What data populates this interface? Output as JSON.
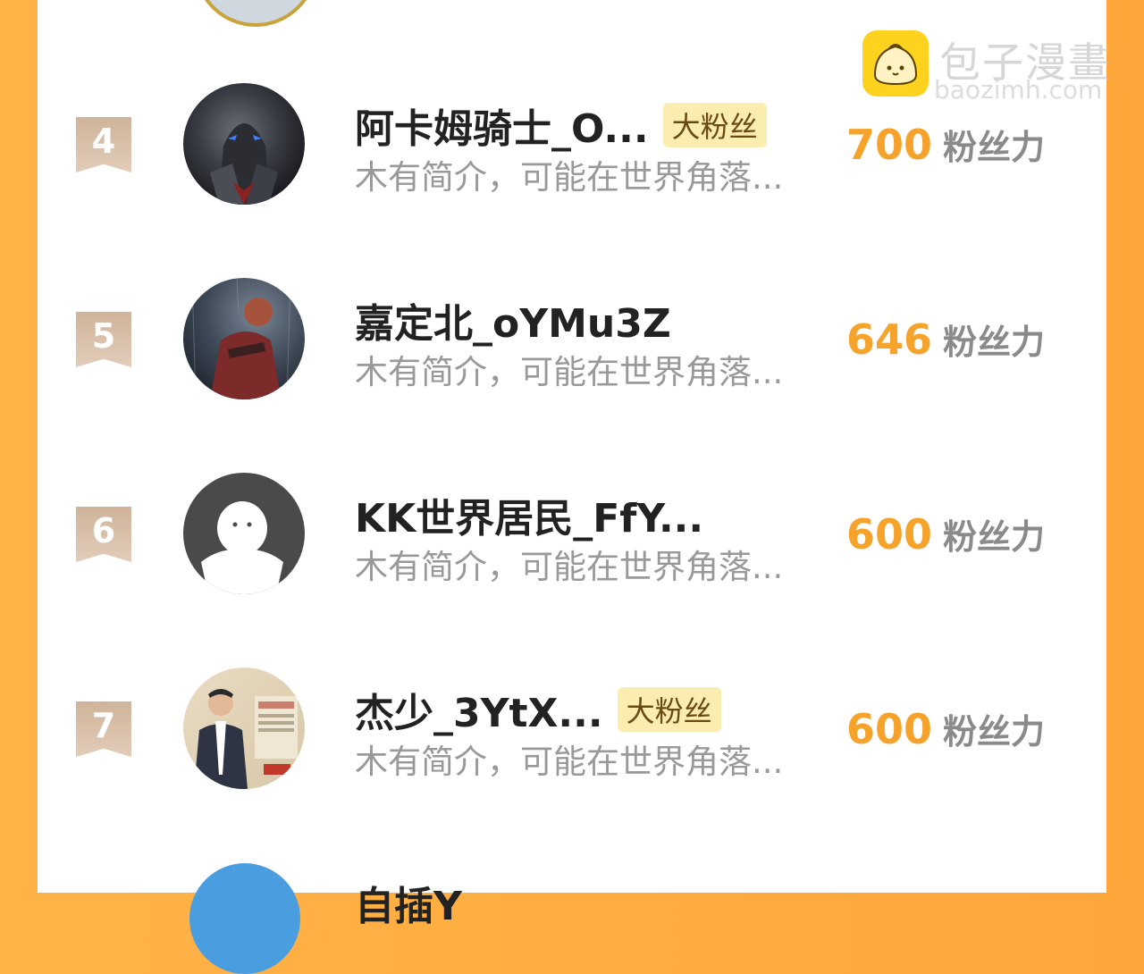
{
  "watermark": {
    "title": "包子漫畫",
    "subtitle": "baozimh.com",
    "icon": "bun-mascot-icon",
    "color": "#ffd21f"
  },
  "colors": {
    "accent": "#f5a32a",
    "badge_bg": "#fbecb0",
    "rank_badge": "#d4b9a2",
    "frame": "#ffa63a"
  },
  "rows": [
    {
      "rank": "4",
      "name": "阿卡姆骑士_O...",
      "badge": "大粉丝",
      "intro": "木有简介，可能在世界角落...",
      "fans": "700",
      "fans_unit": "粉丝力",
      "avatar": "armored-knight-avatar"
    },
    {
      "rank": "5",
      "name": "嘉定北_oYMu3Z",
      "badge": "",
      "intro": "木有简介，可能在世界角落...",
      "fans": "646",
      "fans_unit": "粉丝力",
      "avatar": "rainy-character-avatar"
    },
    {
      "rank": "6",
      "name": "KK世界居民_FfY...",
      "badge": "",
      "intro": "木有简介，可能在世界角落...",
      "fans": "600",
      "fans_unit": "粉丝力",
      "avatar": "default-user-avatar"
    },
    {
      "rank": "7",
      "name": "杰少_3YtX...",
      "badge": "大粉丝",
      "intro": "木有简介，可能在世界角落...",
      "fans": "600",
      "fans_unit": "粉丝力",
      "avatar": "photo-man-avatar"
    },
    {
      "name": "自插Y"
    }
  ]
}
